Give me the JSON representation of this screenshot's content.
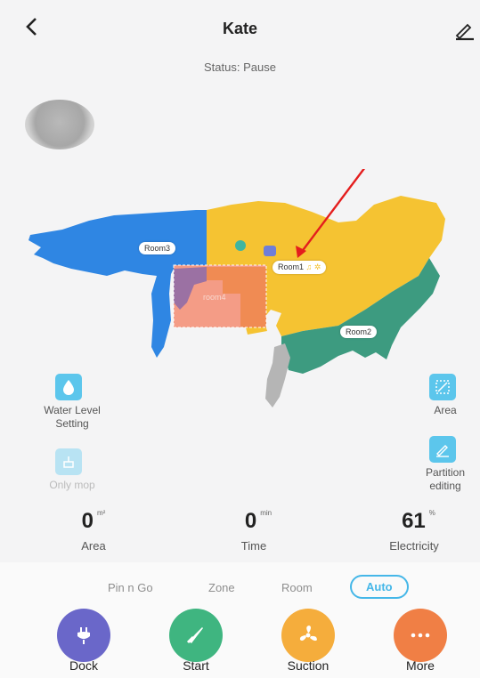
{
  "header": {
    "title": "Kate",
    "status_label": "Status:",
    "status_value": "Pause"
  },
  "map": {
    "rooms": [
      "Room3",
      "Room1",
      "Room2",
      "room4"
    ]
  },
  "side_controls": {
    "water_level": "Water Level\nSetting",
    "only_mop": "Only mop",
    "area": "Area",
    "partition": "Partition\nediting"
  },
  "stats": [
    {
      "value": "0",
      "unit": "m²",
      "label": "Area"
    },
    {
      "value": "0",
      "unit": "min",
      "label": "Time"
    },
    {
      "value": "61",
      "unit": "%",
      "label": "Electricity"
    }
  ],
  "modes": [
    "Pin n Go",
    "Zone",
    "Room",
    "Auto"
  ],
  "selected_mode": "Auto",
  "actions": [
    {
      "label": "Dock",
      "color": "#6a67c9",
      "icon": "plug-icon"
    },
    {
      "label": "Start",
      "color": "#3fb580",
      "icon": "sweep-icon"
    },
    {
      "label": "Suction",
      "color": "#f5ad3c",
      "icon": "fan-icon"
    },
    {
      "label": "More",
      "color": "#f07f45",
      "icon": "more-icon"
    }
  ],
  "colors": {
    "room3": "#2f86e3",
    "room1": "#f5c332",
    "room2": "#3d9b80",
    "room4": "#f49c86",
    "accent": "#45b7e8"
  }
}
